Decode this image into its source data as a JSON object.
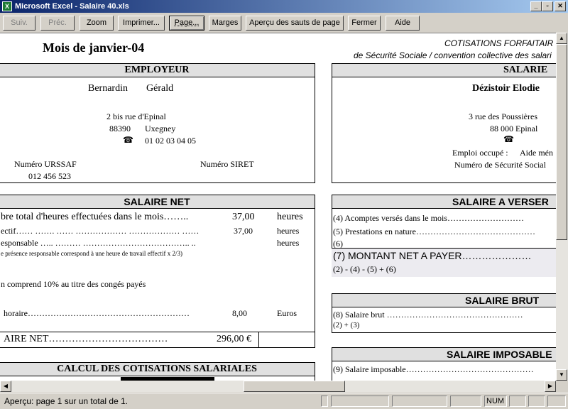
{
  "window": {
    "title": "Microsoft Excel - Salaire 40.xls",
    "app_icon": "X",
    "controls": [
      "_",
      "▫",
      "✕"
    ]
  },
  "toolbar": {
    "buttons": [
      "Suiv.",
      "Préc.",
      "Zoom",
      "Imprimer...",
      "Page...",
      "Marges",
      "Aperçu des sauts de page",
      "Fermer",
      "Aide"
    ]
  },
  "sheet": {
    "month_title": "Mois de janvier-04",
    "cotisations_title": "COTISATIONS FORFAITAIR",
    "cotisations_subtitle": "de Sécurité Sociale / convention collective des salari",
    "employeur": {
      "header": "EMPLOYEUR",
      "lastname": "Bernardin",
      "firstname": "Gérald",
      "address": "2 bis rue d'Epinal",
      "postcode": "88390",
      "city": "Uxegney",
      "phone": "01 02 03 04 05",
      "urssaf_label": "Numéro URSSAF",
      "urssaf_value": "012 456 523",
      "siret_label": "Numéro SIRET"
    },
    "salarie": {
      "header": "SALARIE",
      "name": "Dézistoir  Elodie",
      "address": "3 rue des Poussières",
      "postcode_city": "88 000  Epinal",
      "job_label": "Emploi occupé :",
      "job_value": "Aide mén",
      "ss_label": "Numéro de Sécurité Social"
    },
    "salaire_net": {
      "header": "SALAIRE NET",
      "row1_label": "bre total d'heures effectuées dans le mois……..",
      "row1_value": "37,00",
      "row1_unit": "heures",
      "row2_label": "ectif…… ……. …… ……………… ……………… ……",
      "row2_value": "37,00",
      "row2_unit": "heures",
      "row3_label": "esponsable ….. ……… ……………………………….. ..",
      "row3_unit": "heures",
      "note": "e présence responsable correspond à une heure de travail effectif x 2/3)",
      "conges": "n comprend 10% au titre des congés payés",
      "horaire_label": "horaire…………………………………………………",
      "horaire_value": "8,00",
      "horaire_unit": "Euros",
      "total_label": "AIRE NET………………………………",
      "total_value": "296,00 €"
    },
    "cotisations_salariales": {
      "header": "CALCUL DES COTISATIONS SALARIALES"
    },
    "salaire_a_verser": {
      "header": "SALAIRE A VERSER",
      "line4": "(4)   Acomptes versés dans le mois………………………",
      "line5": "(5)   Prestations en nature……………………………………",
      "line6": "(6)",
      "montant_label": "(7) MONTANT NET A PAYER…………………",
      "formula": "(2) - (4) - (5) + (6)"
    },
    "salaire_brut": {
      "header": "SALAIRE BRUT",
      "line8": "(8) Salaire brut …………………………………………",
      "formula": "(2) + (3)"
    },
    "salaire_imposable": {
      "header": "SALAIRE IMPOSABLE",
      "line9": "(9) Salaire imposable………………………………………"
    }
  },
  "statusbar": {
    "message": "Aperçu: page 1 sur un total de 1.",
    "num": "NUM"
  }
}
